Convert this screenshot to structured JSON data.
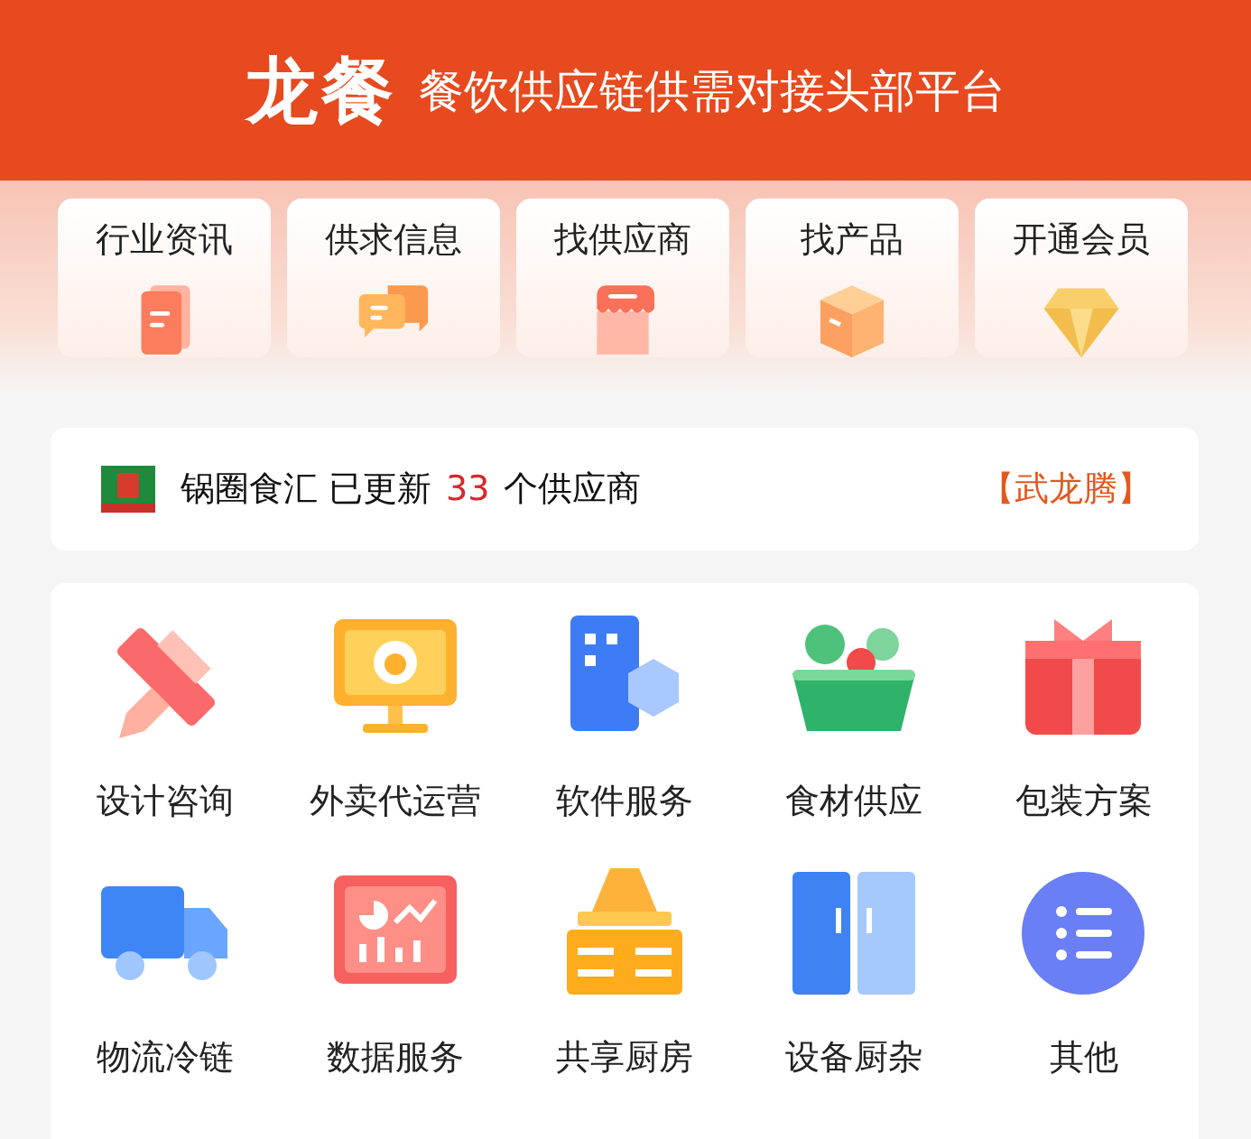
{
  "header": {
    "logo": "龙餐",
    "slogan": "餐饮供应链供需对接头部平台"
  },
  "quick_links": [
    {
      "label": "行业资讯"
    },
    {
      "label": "供求信息"
    },
    {
      "label": "找供应商"
    },
    {
      "label": "找产品"
    },
    {
      "label": "开通会员"
    }
  ],
  "notice": {
    "text": "锅圈食汇 已更新",
    "count": "33",
    "suffix": "个供应商",
    "tag": "【武龙腾】"
  },
  "services": [
    {
      "label": "设计咨询"
    },
    {
      "label": "外卖代运营"
    },
    {
      "label": "软件服务"
    },
    {
      "label": "食材供应"
    },
    {
      "label": "包装方案"
    },
    {
      "label": "物流冷链"
    },
    {
      "label": "数据服务"
    },
    {
      "label": "共享厨房"
    },
    {
      "label": "设备厨杂"
    },
    {
      "label": "其他"
    }
  ]
}
